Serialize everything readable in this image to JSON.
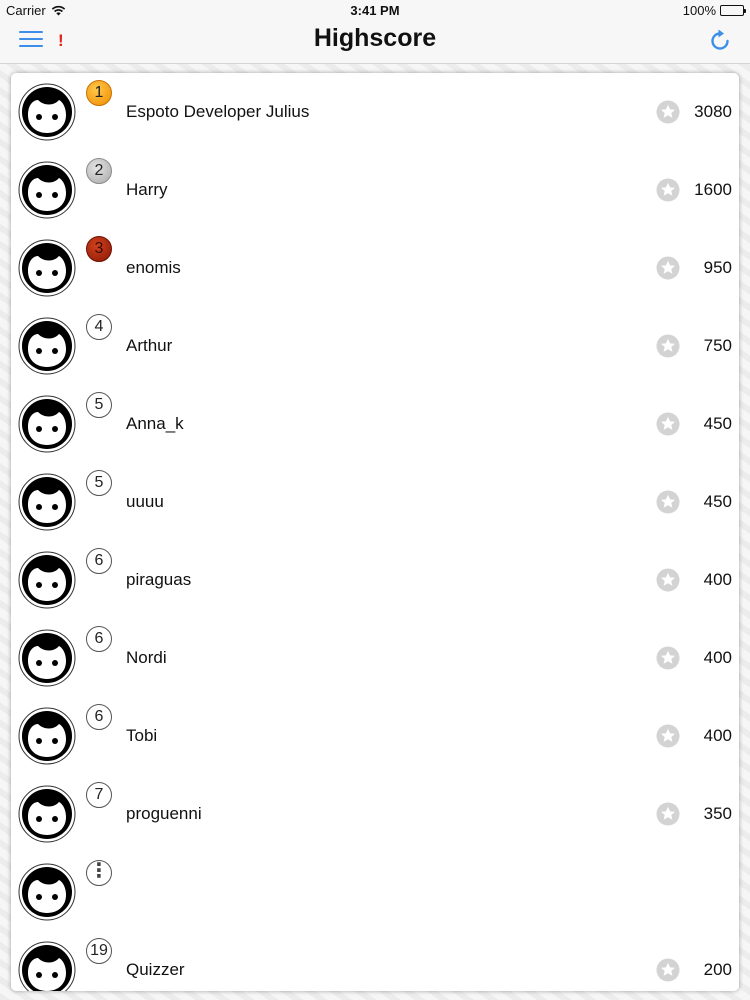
{
  "status_bar": {
    "carrier": "Carrier",
    "time": "3:41 PM",
    "battery": "100%"
  },
  "nav": {
    "title": "Highscore",
    "alert": "!",
    "menu_icon": "hamburger-menu-icon",
    "refresh_icon": "refresh-icon"
  },
  "colors": {
    "accent": "#3d8ee8",
    "alert": "#e0241c",
    "star": "#d3d3d3"
  },
  "players": [
    {
      "rank": "1",
      "medal": "gold",
      "name": "Espoto Developer Julius",
      "score": "3080"
    },
    {
      "rank": "2",
      "medal": "silver",
      "name": "Harry",
      "score": "1600"
    },
    {
      "rank": "3",
      "medal": "bronze",
      "name": "enomis",
      "score": "950"
    },
    {
      "rank": "4",
      "medal": "",
      "name": "Arthur",
      "score": "750"
    },
    {
      "rank": "5",
      "medal": "",
      "name": "Anna_k",
      "score": "450"
    },
    {
      "rank": "5",
      "medal": "",
      "name": "uuuu",
      "score": "450"
    },
    {
      "rank": "6",
      "medal": "",
      "name": "piraguas",
      "score": "400"
    },
    {
      "rank": "6",
      "medal": "",
      "name": "Nordi",
      "score": "400"
    },
    {
      "rank": "6",
      "medal": "",
      "name": "Tobi",
      "score": "400"
    },
    {
      "rank": "7",
      "medal": "",
      "name": "proguenni",
      "score": "350"
    },
    {
      "rank": "⋮",
      "medal": "more",
      "name": "",
      "score": ""
    },
    {
      "rank": "19",
      "medal": "",
      "name": "Quizzer",
      "score": "200"
    }
  ]
}
